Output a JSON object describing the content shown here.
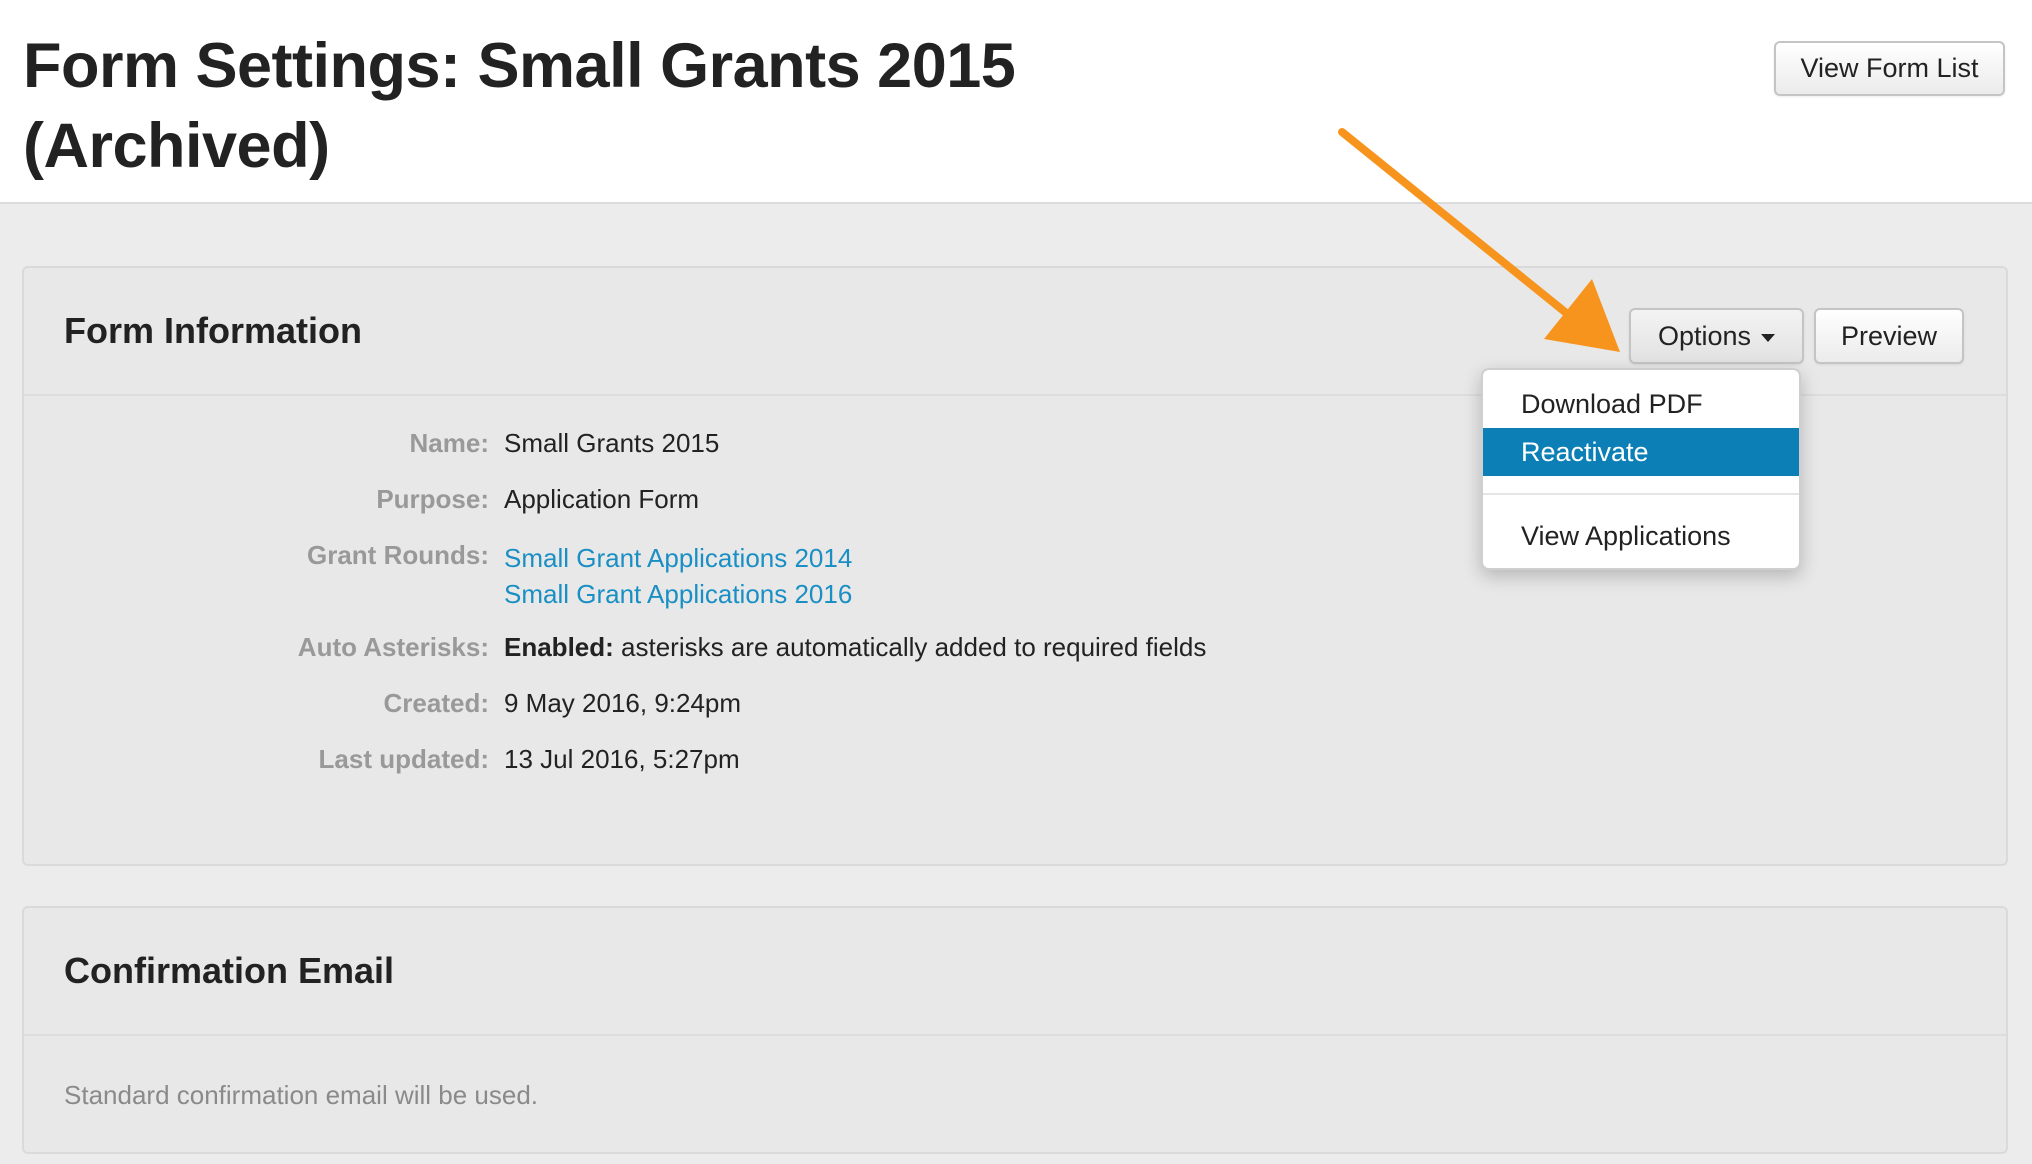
{
  "header": {
    "title": "Form Settings: Small Grants 2015 (Archived)",
    "view_form_list_label": "View Form List"
  },
  "form_info": {
    "title": "Form Information",
    "options_label": "Options",
    "preview_label": "Preview",
    "fields": {
      "name": {
        "label": "Name:",
        "value": "Small Grants 2015"
      },
      "purpose": {
        "label": "Purpose:",
        "value": "Application Form"
      },
      "grant_rounds": {
        "label": "Grant Rounds:",
        "links": [
          "Small Grant Applications 2014",
          "Small Grant Applications 2016"
        ]
      },
      "auto_asterisks": {
        "label": "Auto Asterisks:",
        "status": "Enabled:",
        "description": "asterisks are automatically added to required fields"
      },
      "created": {
        "label": "Created:",
        "value": "9 May 2016, 9:24pm"
      },
      "last_updated": {
        "label": "Last updated:",
        "value": "13 Jul 2016, 5:27pm"
      }
    }
  },
  "options_menu": {
    "items": [
      {
        "label": "Download PDF",
        "active": false
      },
      {
        "label": "Reactivate",
        "active": true
      },
      {
        "label": "View Applications",
        "active": false
      }
    ]
  },
  "confirmation_email": {
    "title": "Confirmation Email",
    "text": "Standard confirmation email will be used."
  },
  "colors": {
    "accent": "#0b7fb6",
    "link": "#1a8fc4",
    "annotation_arrow": "#f7941d"
  },
  "icons": {
    "options_caret": "caret-down-icon",
    "annotation": "arrow-annotation-icon"
  }
}
